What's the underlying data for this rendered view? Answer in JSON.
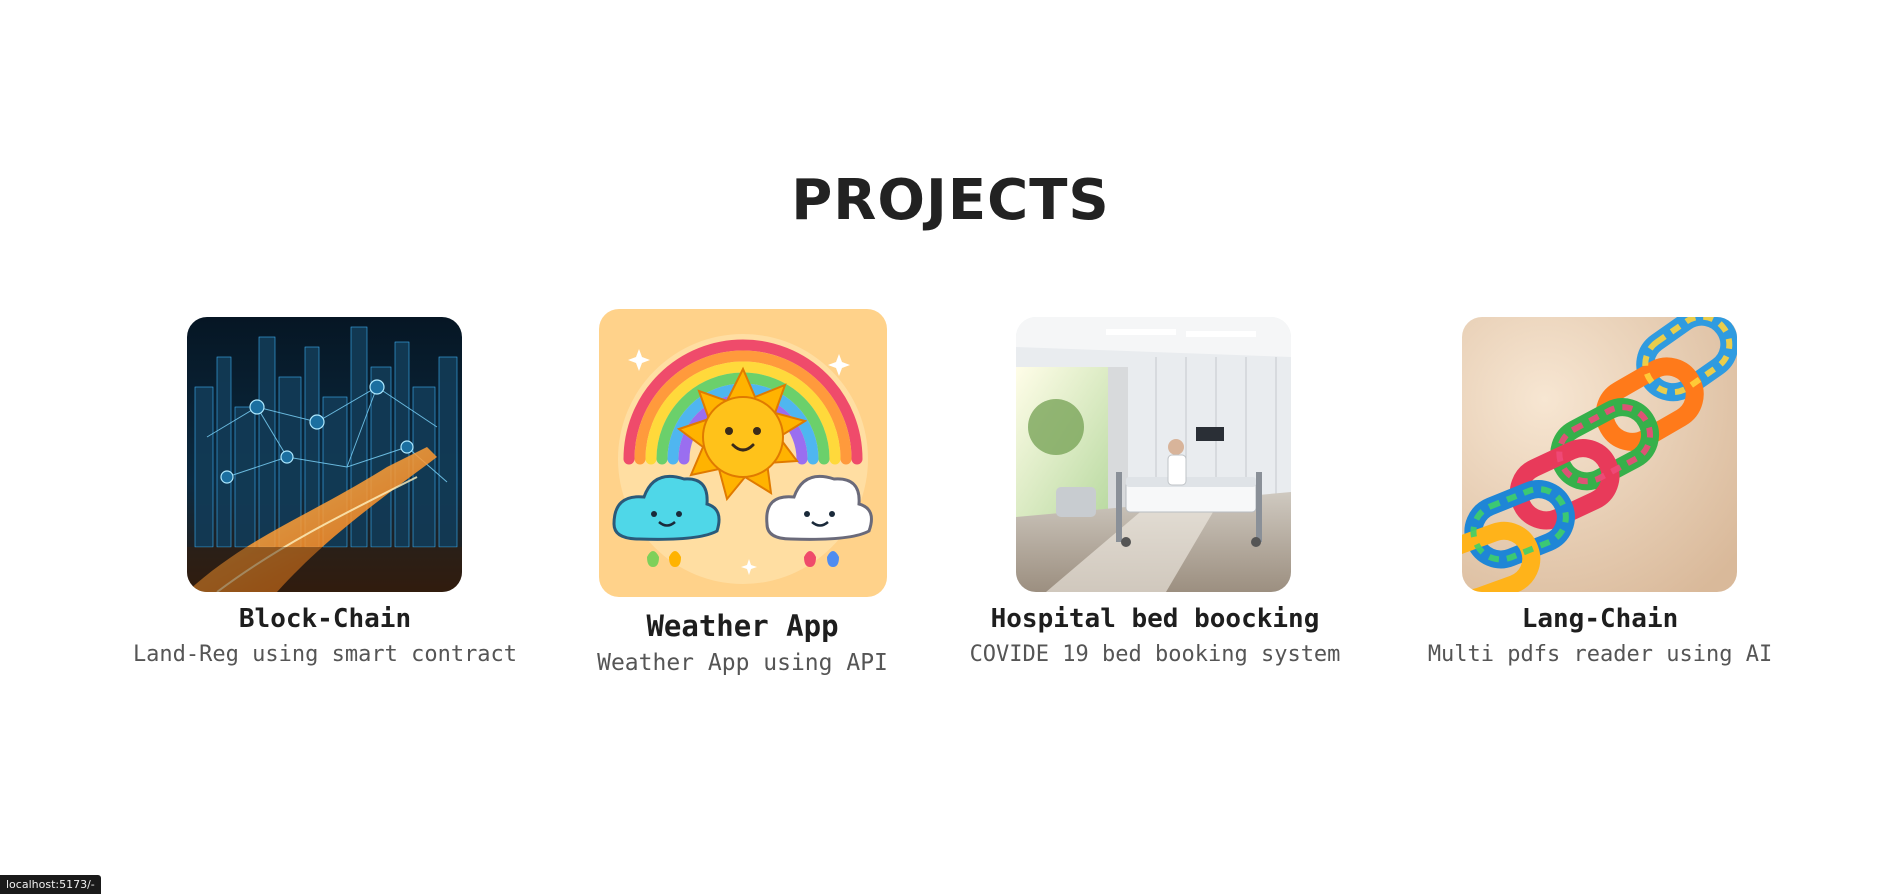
{
  "section": {
    "title": "PROJECTS"
  },
  "projects": [
    {
      "name": "Block-Chain",
      "description": "Land-Reg using smart contract",
      "image": "blockchain-city-image"
    },
    {
      "name": "Weather App",
      "description": "Weather App using API",
      "image": "rainbow-sun-clouds-image"
    },
    {
      "name": "Hospital bed boocking",
      "description": "COVIDE 19 bed booking system",
      "image": "hospital-room-image"
    },
    {
      "name": "Lang-Chain",
      "description": "Multi pdfs reader using AI",
      "image": "colorful-chain-links-image"
    }
  ],
  "status_bar": {
    "url": "localhost:5173/-"
  }
}
